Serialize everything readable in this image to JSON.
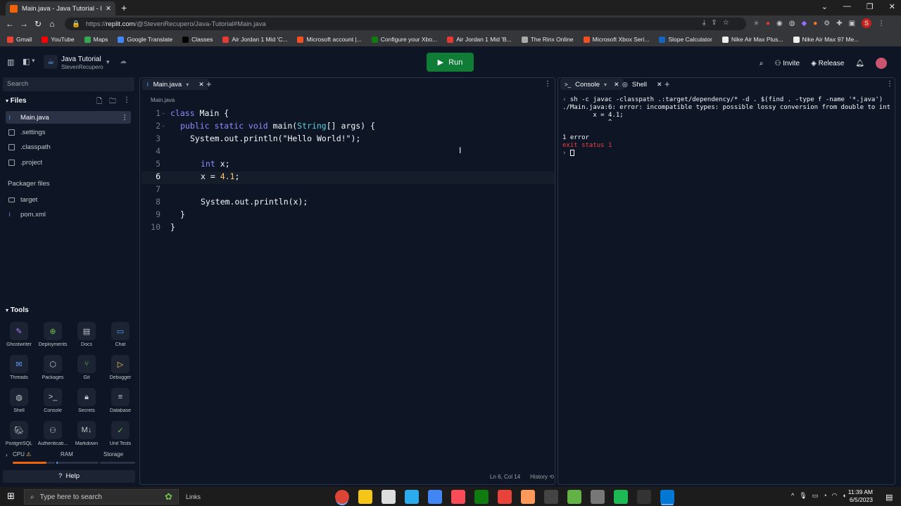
{
  "browser": {
    "tab_title": "Main.java - Java Tutorial - Replit",
    "url_scheme": "https://",
    "url_host": "replit.com",
    "url_path": "/@StevenRecupero/Java-Tutorial#Main.java",
    "bookmarks": [
      "Gmail",
      "YouTube",
      "Maps",
      "Google Translate",
      "Classes",
      "Air Jordan 1 Mid 'C...",
      "Microsoft account |...",
      "Configure your Xbo...",
      "Air Jordan 1 Mid 'B...",
      "The Rinx Online",
      "Microsoft Xbox Seri...",
      "Slope Calculator",
      "Nike Air Max Plus...",
      "Nike Air Max 97 Me..."
    ],
    "profile_initial": "S"
  },
  "header": {
    "project_name": "Java Tutorial",
    "owner": "StevenRecupero",
    "run_label": "Run",
    "invite_label": "Invite",
    "release_label": "Release"
  },
  "sidebar": {
    "search_placeholder": "Search",
    "files_title": "Files",
    "files": [
      ".settings",
      ".classpath",
      ".project"
    ],
    "active_file": "Main.java",
    "packager_title": "Packager files",
    "packager_files": [
      "target",
      "pom.xml"
    ],
    "tools_title": "Tools",
    "tools": [
      "Ghostwriter",
      "Deployments",
      "Docs",
      "Chat",
      "Threads",
      "Packages",
      "Git",
      "Debugger",
      "Shell",
      "Console",
      "Secrets",
      "Database",
      "PostgreSQL",
      "Authenticati...",
      "Markdown",
      "Unit Tests"
    ],
    "resources": [
      "CPU",
      "RAM",
      "Storage"
    ],
    "help_label": "Help"
  },
  "editor": {
    "tab": "Main.java",
    "path": "Main.java",
    "line_numbers": [
      "1",
      "2",
      "3",
      "4",
      "5",
      "6",
      "7",
      "8",
      "9",
      "10"
    ],
    "code": {
      "l1_kw": "class",
      "l1_rest": " Main {",
      "l2_kw": "public static void",
      "l2_rest": " main(",
      "l2_ty": "String",
      "l2_rest2": "[] args) {",
      "l3": "System.out.println(\"Hello World!\");",
      "l5_ty": "int",
      "l5_rest": " x;",
      "l6_a": "x = ",
      "l6_num": "4.1",
      "l6_b": ";",
      "l8": "System.out.println(x);",
      "l9": "}",
      "l10": "}"
    },
    "status_pos": "Ln 6, Col 14",
    "history_label": "History"
  },
  "console": {
    "tabs": [
      "Console",
      "Shell"
    ],
    "lines": [
      "sh -c javac -classpath .:target/dependency/* -d . $(find . -type f -name '*.java')",
      "./Main.java:6: error: incompatible types: possible lossy conversion from double to int",
      "        x = 4.1;",
      "            ^",
      "1 error"
    ],
    "exit_line": "exit status 1"
  },
  "taskbar": {
    "search_placeholder": "Type here to search",
    "links_label": "Links",
    "time": "11:39 AM",
    "date": "6/5/2023"
  }
}
